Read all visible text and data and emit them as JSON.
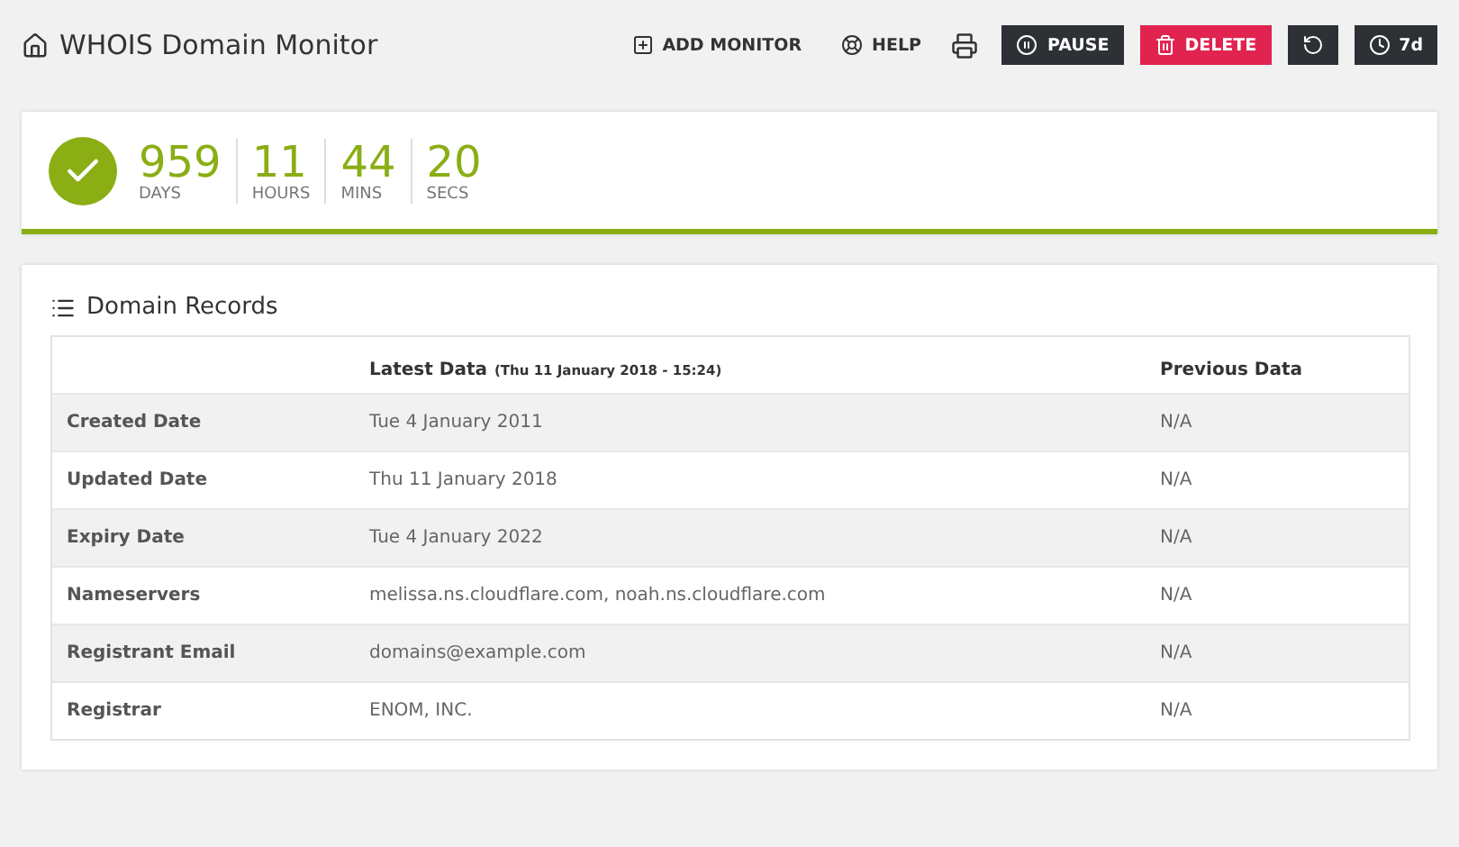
{
  "header": {
    "title": "WHOIS Domain Monitor"
  },
  "toolbar": [
    {
      "kind": "link",
      "label": "ADD MONITOR"
    },
    {
      "kind": "link",
      "label": "HELP"
    },
    {
      "kind": "plain"
    },
    {
      "kind": "dark",
      "label": "PAUSE"
    },
    {
      "kind": "danger",
      "label": "DELETE"
    },
    {
      "kind": "dark"
    },
    {
      "kind": "dark",
      "label": "7d"
    }
  ],
  "countdown": {
    "units": [
      {
        "value": "959",
        "unit": "DAYS"
      },
      {
        "value": "11",
        "unit": "HOURS"
      },
      {
        "value": "44",
        "unit": "MINS"
      },
      {
        "value": "20",
        "unit": "SECS"
      }
    ]
  },
  "records": {
    "title": "Domain Records",
    "columns": [
      {},
      {
        "label": "Latest Data",
        "note": "(Thu 11 January 2018 - 15:24)"
      },
      {
        "label": "Previous Data"
      }
    ],
    "rows": [
      {
        "field": "Created Date",
        "latest": "Tue 4 January 2011",
        "previous": "N/A"
      },
      {
        "field": "Updated Date",
        "latest": "Thu 11 January 2018",
        "previous": "N/A"
      },
      {
        "field": "Expiry Date",
        "latest": "Tue 4 January 2022",
        "previous": "N/A"
      },
      {
        "field": "Nameservers",
        "latest": "melissa.ns.cloudflare.com, noah.ns.cloudflare.com",
        "previous": "N/A"
      },
      {
        "field": "Registrant Email",
        "latest": "domains@example.com",
        "previous": "N/A"
      },
      {
        "field": "Registrar",
        "latest": "ENOM, INC.",
        "previous": "N/A"
      }
    ]
  }
}
